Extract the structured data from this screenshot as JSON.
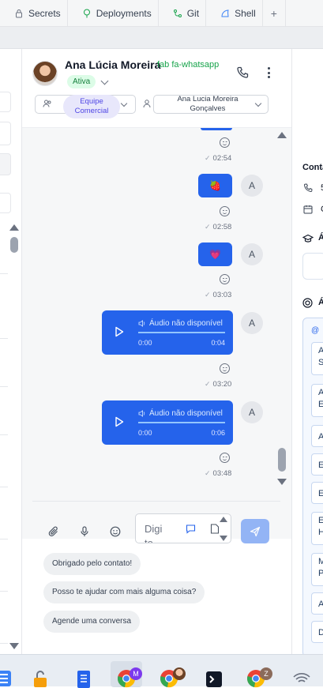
{
  "tabs": [
    {
      "label": "Secrets",
      "icon": "lock-icon"
    },
    {
      "label": "Deployments",
      "icon": "tree-icon"
    },
    {
      "label": "Git",
      "icon": "git-icon"
    },
    {
      "label": "Shell",
      "icon": "shell-icon"
    }
  ],
  "tab_add_label": "+",
  "chat": {
    "contact_name": "Ana Lúcia Moreira",
    "channel_label": "fab fa-whatsapp",
    "status": "Ativa",
    "team_label": "Equipe Comercial",
    "agent_label": "Ana Lucia Moreira Gonçalves",
    "sender_initial": "A"
  },
  "messages": [
    {
      "type": "emoji",
      "content": "🍓",
      "time": "02:58"
    },
    {
      "type": "emoji",
      "content": "💗",
      "time": "03:03"
    },
    {
      "type": "audio",
      "title": "Áudio não disponível",
      "start": "0:00",
      "duration": "0:04",
      "time": "03:20"
    },
    {
      "type": "audio",
      "title": "Áudio não disponível",
      "start": "0:00",
      "duration": "0:06",
      "time": "03:48"
    }
  ],
  "first_time": "02:54",
  "composer": {
    "input_value": "Digi to",
    "send_icon": "send-icon"
  },
  "quick_replies": [
    "Obrigado pelo contato!",
    "Posso te ajudar com mais alguma coisa?",
    "Agende uma conversa"
  ],
  "right_panel": {
    "contact_heading": "Conta",
    "phone_value": "5",
    "date_value": "C",
    "section_1": "Á",
    "section_2": "Á",
    "list_header": "@ ",
    "list_items": [
      "A S",
      "A E",
      "A",
      "E",
      "E",
      "E H",
      "M P",
      "A",
      "D"
    ]
  },
  "taskbar": {
    "badge_m": "M",
    "badge_z": "Z"
  },
  "colors": {
    "accent": "#2563eb",
    "status_bg": "#dcfce7",
    "team_pill": "#e8e7fb",
    "whatsapp": "#16a34a"
  }
}
